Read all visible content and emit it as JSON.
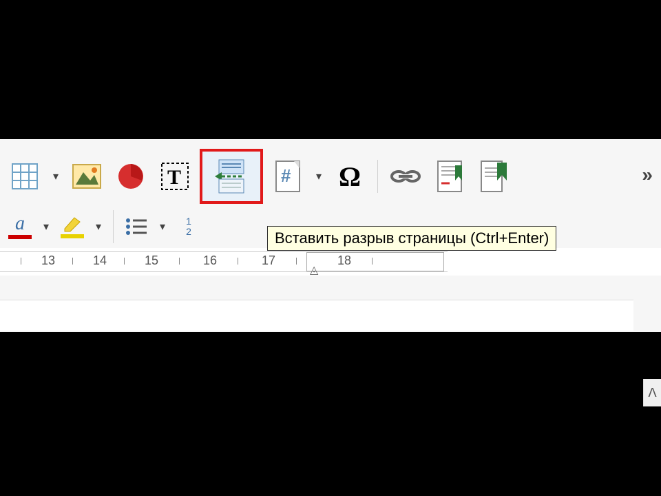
{
  "tooltip": {
    "page_break": "Вставить разрыв страницы (Ctrl+Enter)"
  },
  "toolbar": {
    "row1": {
      "table": "insert-table",
      "image": "insert-image",
      "chart": "insert-chart",
      "textbox": "insert-text-box",
      "page_break": "insert-page-break",
      "field": "insert-field",
      "special_char": "insert-special-character",
      "special_char_glyph": "Ω",
      "hyperlink": "insert-hyperlink",
      "footnote": "insert-footnote",
      "bookmark": "insert-bookmark",
      "overflow": "»"
    },
    "row2": {
      "font_color": "font-color",
      "highlight_color": "highlighting-color",
      "bullet_list": "bullet-list",
      "number_list": "numbered-list",
      "num1": "1",
      "num2": "2"
    }
  },
  "ruler": {
    "marks": [
      "13",
      "14",
      "15",
      "16",
      "17",
      "18"
    ]
  },
  "scrollbar": {
    "up_glyph": "ᐱ"
  }
}
